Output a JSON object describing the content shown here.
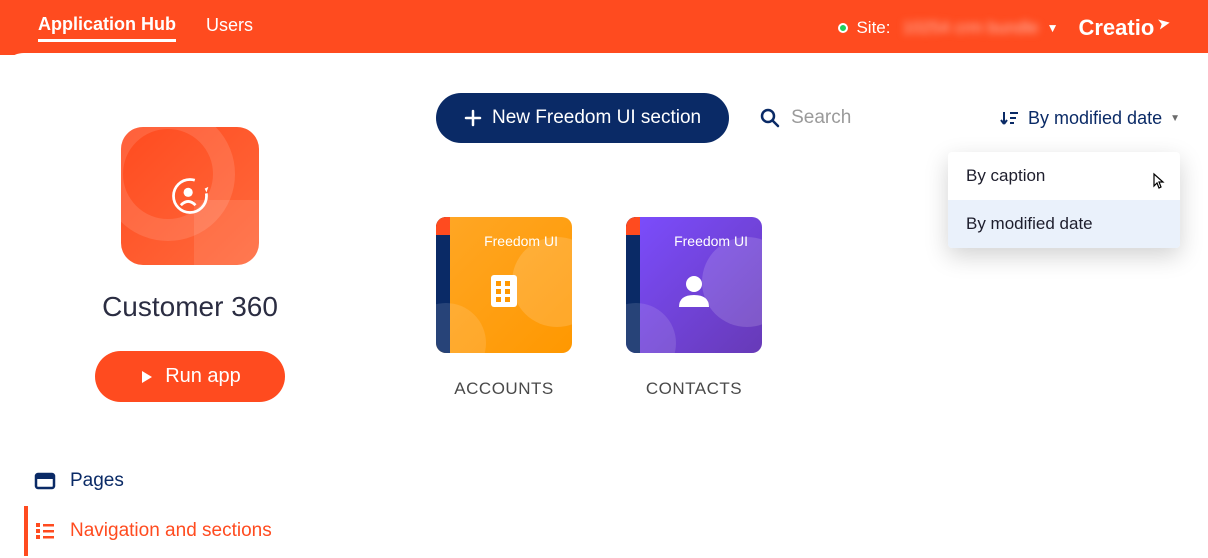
{
  "topbar": {
    "tabs": [
      {
        "label": "Application Hub",
        "active": true
      },
      {
        "label": "Users",
        "active": false
      }
    ],
    "site_label": "Site:",
    "site_value": "10254 crm bundle",
    "logo": "Creatio"
  },
  "app": {
    "title": "Customer 360",
    "run_label": "Run app"
  },
  "side_menu": {
    "items": [
      {
        "label": "Pages",
        "active": false
      },
      {
        "label": "Navigation and sections",
        "active": true
      }
    ]
  },
  "toolbar": {
    "new_section_label": "New Freedom UI section",
    "search_placeholder": "Search",
    "sort_label": "By modified date"
  },
  "sort_dropdown": {
    "options": [
      {
        "label": "By caption",
        "selected": false
      },
      {
        "label": "By modified date",
        "selected": true
      }
    ]
  },
  "cards": [
    {
      "badge": "Freedom UI",
      "label": "ACCOUNTS",
      "color": "orange"
    },
    {
      "badge": "Freedom UI",
      "label": "CONTACTS",
      "color": "purple"
    }
  ]
}
